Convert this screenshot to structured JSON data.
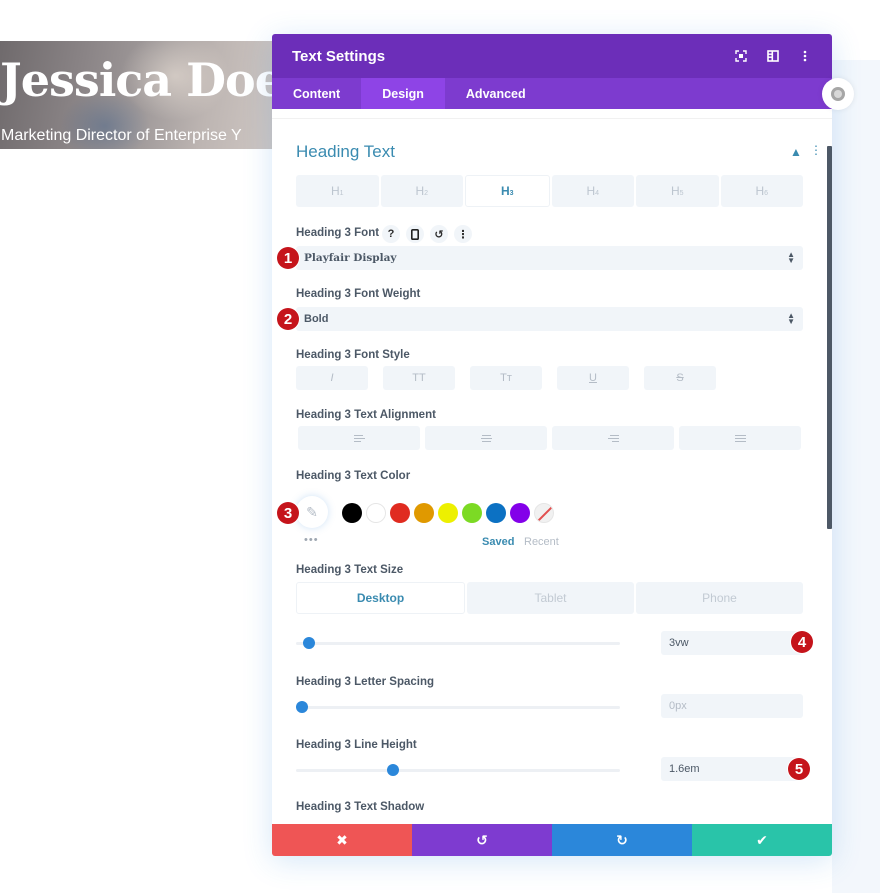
{
  "hero": {
    "name": "Jessica Doe",
    "subtitle": "Marketing Director of Enterprise Y"
  },
  "panel": {
    "title": "Text Settings",
    "header_icons": [
      "expand-icon",
      "split-view-icon",
      "more-vertical-icon"
    ],
    "tabs": [
      {
        "label": "Content",
        "active": false
      },
      {
        "label": "Design",
        "active": true
      },
      {
        "label": "Advanced",
        "active": false
      }
    ],
    "section": {
      "title": "Heading Text",
      "heading_tabs": [
        {
          "label": "H",
          "sub": "1",
          "active": false
        },
        {
          "label": "H",
          "sub": "2",
          "active": false
        },
        {
          "label": "H",
          "sub": "3",
          "active": true
        },
        {
          "label": "H",
          "sub": "4",
          "active": false
        },
        {
          "label": "H",
          "sub": "5",
          "active": false
        },
        {
          "label": "H",
          "sub": "6",
          "active": false
        }
      ],
      "font": {
        "label": "Heading 3 Font",
        "tools": [
          "?",
          "▯",
          "↺",
          "⋮"
        ],
        "value": "Playfair Display",
        "badge": "1"
      },
      "font_weight": {
        "label": "Heading 3 Font Weight",
        "value": "Bold",
        "badge": "2"
      },
      "font_style": {
        "label": "Heading 3 Font Style",
        "options": [
          "I",
          "TT",
          "Tт",
          "U",
          "S"
        ]
      },
      "text_alignment": {
        "label": "Heading 3 Text Alignment",
        "options": [
          "left",
          "center",
          "right",
          "justify"
        ]
      },
      "text_color": {
        "label": "Heading 3 Text Color",
        "badge": "3",
        "swatches": [
          "#000000",
          "#ffffff",
          "#e02b20",
          "#e09900",
          "#edf000",
          "#7cda24",
          "#0c71c3",
          "#8300e9",
          "none"
        ],
        "saved_label": "Saved",
        "recent_label": "Recent",
        "more": "•••"
      },
      "text_size": {
        "label": "Heading 3 Text Size",
        "devices": [
          {
            "label": "Desktop",
            "active": true
          },
          {
            "label": "Tablet",
            "active": false
          },
          {
            "label": "Phone",
            "active": false
          }
        ],
        "slider_fraction": 0.04,
        "value": "3vw",
        "badge": "4"
      },
      "letter_spacing": {
        "label": "Heading 3 Letter Spacing",
        "slider_fraction": 0.0,
        "value": "0px"
      },
      "line_height": {
        "label": "Heading 3 Line Height",
        "slider_fraction": 0.3,
        "value": "1.6em",
        "badge": "5"
      },
      "text_shadow": {
        "label": "Heading 3 Text Shadow"
      }
    },
    "footer": {
      "cancel": "✖",
      "undo": "↺",
      "redo": "↻",
      "save": "✔"
    }
  }
}
